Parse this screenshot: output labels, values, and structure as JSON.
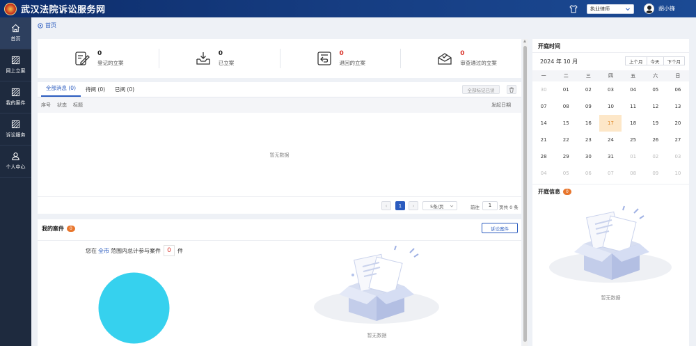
{
  "header": {
    "site_title": "武汉法院诉讼服务网",
    "role": "执业律师",
    "username": "胡小锋"
  },
  "sidebar": {
    "items": [
      {
        "label": "首页",
        "icon": "home-icon"
      },
      {
        "label": "网上立案",
        "icon": "striped-square-icon"
      },
      {
        "label": "我的案件",
        "icon": "striped-square-icon"
      },
      {
        "label": "诉讼服务",
        "icon": "striped-square-icon"
      },
      {
        "label": "个人中心",
        "icon": "user-icon"
      }
    ]
  },
  "breadcrumb": {
    "label": "首页"
  },
  "stats": [
    {
      "value": "0",
      "label": "登记的立案"
    },
    {
      "value": "0",
      "label": "已立案"
    },
    {
      "value": "0",
      "label": "退回的立案"
    },
    {
      "value": "0",
      "label": "审查通过的立案"
    }
  ],
  "messages": {
    "tabs": [
      "全部消息 (0)",
      "待阅 (0)",
      "已阅 (0)"
    ],
    "mark_all_read": "全部标记已读",
    "columns": [
      "序号",
      "状态",
      "标题"
    ],
    "date_column": "发起日期",
    "empty": "暂无数据",
    "pager": {
      "current": "1",
      "page_size": "5条/页",
      "goto_label": "前往",
      "goto_value": "1",
      "total": "页共 0 条"
    }
  },
  "cases": {
    "title": "我的案件",
    "badge": "0",
    "sue_button": "诉讼案件",
    "summary_prefix": "您在",
    "summary_city": "全市",
    "summary_middle": "范围内总计参与案件",
    "summary_count": "0",
    "summary_suffix": "件",
    "empty": "暂无数据"
  },
  "calendar": {
    "title": "开庭时间",
    "month": "2024 年 10 月",
    "buttons": [
      "上个月",
      "今天",
      "下个月"
    ],
    "weekdays": [
      "一",
      "二",
      "三",
      "四",
      "五",
      "六",
      "日"
    ],
    "weeks": [
      [
        {
          "d": "30",
          "dim": true
        },
        {
          "d": "01"
        },
        {
          "d": "02"
        },
        {
          "d": "03"
        },
        {
          "d": "04"
        },
        {
          "d": "05"
        },
        {
          "d": "06"
        }
      ],
      [
        {
          "d": "07"
        },
        {
          "d": "08"
        },
        {
          "d": "09"
        },
        {
          "d": "10"
        },
        {
          "d": "11"
        },
        {
          "d": "12"
        },
        {
          "d": "13"
        }
      ],
      [
        {
          "d": "14"
        },
        {
          "d": "15"
        },
        {
          "d": "16"
        },
        {
          "d": "17",
          "today": true
        },
        {
          "d": "18"
        },
        {
          "d": "19"
        },
        {
          "d": "20"
        }
      ],
      [
        {
          "d": "21"
        },
        {
          "d": "22"
        },
        {
          "d": "23"
        },
        {
          "d": "24"
        },
        {
          "d": "25"
        },
        {
          "d": "26"
        },
        {
          "d": "27"
        }
      ],
      [
        {
          "d": "28"
        },
        {
          "d": "29"
        },
        {
          "d": "30"
        },
        {
          "d": "31"
        },
        {
          "d": "01",
          "dim": true
        },
        {
          "d": "02",
          "dim": true
        },
        {
          "d": "03",
          "dim": true
        }
      ],
      [
        {
          "d": "04",
          "dim": true
        },
        {
          "d": "05",
          "dim": true
        },
        {
          "d": "06",
          "dim": true
        },
        {
          "d": "07",
          "dim": true
        },
        {
          "d": "08",
          "dim": true
        },
        {
          "d": "09",
          "dim": true
        },
        {
          "d": "10",
          "dim": true
        }
      ]
    ]
  },
  "hearing": {
    "title": "开庭信息",
    "badge": "0",
    "empty": "暂无数据"
  },
  "colors": {
    "primary": "#2a5bbf",
    "header": "#163d82",
    "sidebar": "#1e2a3e",
    "danger": "#d9342b",
    "badge": "#e8762d",
    "pie": "#36d1ee",
    "today_bg": "#fde7c8"
  }
}
